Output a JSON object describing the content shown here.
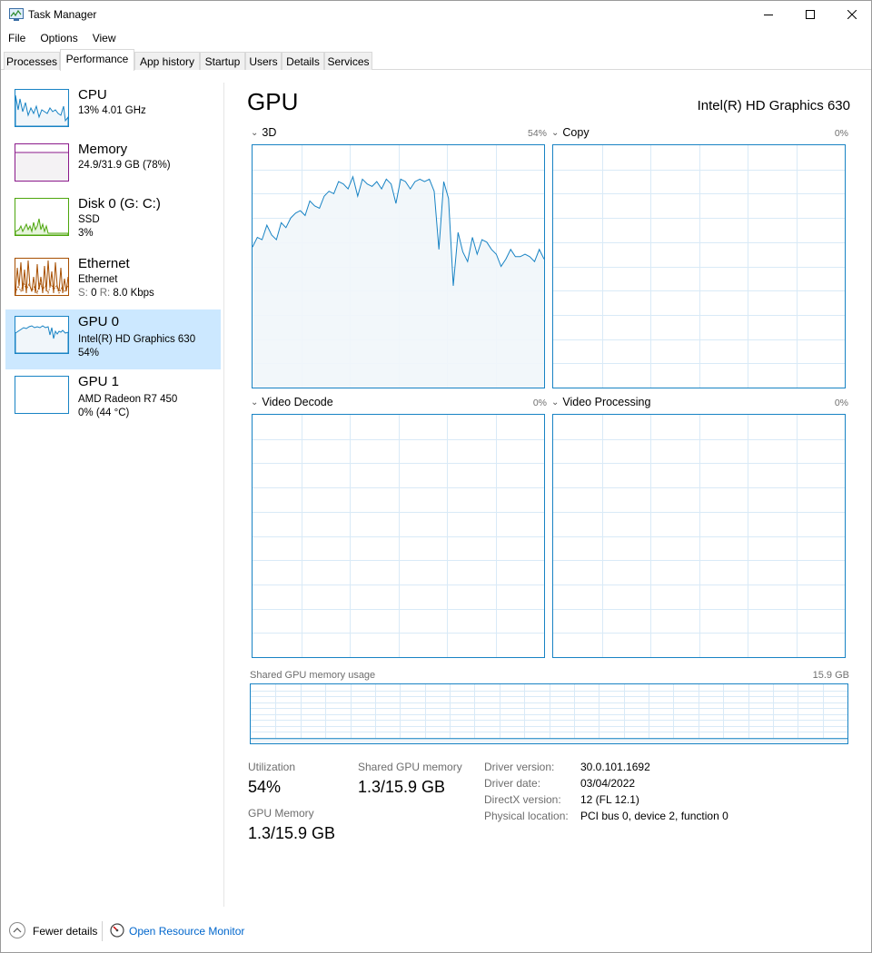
{
  "window": {
    "title": "Task Manager"
  },
  "menu": [
    "File",
    "Options",
    "View"
  ],
  "tabs": [
    "Processes",
    "Performance",
    "App history",
    "Startup",
    "Users",
    "Details",
    "Services"
  ],
  "active_tab": "Performance",
  "sidebar": {
    "items": [
      {
        "title": "CPU",
        "lines": [
          "13%  4.01 GHz"
        ],
        "color": "#1883c4"
      },
      {
        "title": "Memory",
        "lines": [
          "24.9/31.9 GB (78%)"
        ],
        "color": "#8b1a8b"
      },
      {
        "title": "Disk 0 (G: C:)",
        "lines": [
          "SSD",
          "3%"
        ],
        "color": "#4da60c"
      },
      {
        "title": "Ethernet",
        "lines": [
          "Ethernet"
        ],
        "send_label": "S:",
        "send_value": "0",
        "recv_label": "R:",
        "recv_value": "8.0 Kbps",
        "color": "#a74f01"
      },
      {
        "title": "GPU 0",
        "lines": [
          "Intel(R) HD Graphics 630",
          "54%"
        ],
        "color": "#1883c4"
      },
      {
        "title": "GPU 1",
        "lines": [
          "AMD Radeon R7 450",
          "0% (44 °C)"
        ],
        "color": "#1883c4"
      }
    ],
    "selected_index": 4
  },
  "main": {
    "title": "GPU",
    "device_name": "Intel(R) HD Graphics 630",
    "engines": [
      {
        "label": "3D",
        "percent": "54%"
      },
      {
        "label": "Copy",
        "percent": "0%"
      },
      {
        "label": "Video Decode",
        "percent": "0%"
      },
      {
        "label": "Video Processing",
        "percent": "0%"
      }
    ],
    "shared_memory_graph": {
      "label": "Shared GPU memory usage",
      "max": "15.9 GB"
    },
    "stats": {
      "utilization_label": "Utilization",
      "utilization_value": "54%",
      "shared_label": "Shared GPU memory",
      "shared_value": "1.3/15.9 GB",
      "gpu_memory_label": "GPU Memory",
      "gpu_memory_value": "1.3/15.9 GB"
    },
    "info": [
      {
        "label": "Driver version:",
        "value": "30.0.101.1692"
      },
      {
        "label": "Driver date:",
        "value": "03/04/2022"
      },
      {
        "label": "DirectX version:",
        "value": "12 (FL 12.1)"
      },
      {
        "label": "Physical location:",
        "value": "PCI bus 0, device 2, function 0"
      }
    ]
  },
  "footer": {
    "fewer_details": "Fewer details",
    "resource_monitor": "Open Resource Monitor"
  },
  "colors": {
    "accent": "#1883c4",
    "selection": "#cce8ff",
    "link": "#0066cc"
  },
  "graph_3d_samples": [
    58,
    62,
    61,
    67,
    63,
    61,
    68,
    66,
    70,
    72,
    73,
    71,
    77,
    75,
    74,
    79,
    81,
    80,
    85,
    84,
    82,
    87,
    79,
    86,
    84,
    83,
    85,
    82,
    86,
    84,
    76,
    86,
    85,
    82,
    85,
    86,
    85,
    86,
    81,
    57,
    85,
    78,
    42,
    64,
    56,
    52,
    62,
    55,
    61,
    60,
    57,
    55,
    50,
    53,
    57,
    54,
    54,
    55,
    54,
    52,
    57,
    53
  ],
  "graph_shared_memory_samples": [
    8,
    8,
    8,
    8,
    8,
    8,
    8,
    8,
    8,
    8,
    8,
    8,
    8,
    8,
    8,
    8,
    8,
    8,
    8,
    8,
    8,
    8,
    8,
    8,
    8,
    8,
    8,
    8,
    8,
    8,
    8,
    8,
    8,
    8,
    8,
    8,
    8,
    8,
    8,
    8,
    8,
    8,
    8,
    8,
    8,
    8,
    8,
    8,
    8,
    8,
    8,
    8,
    8,
    8,
    8,
    8,
    8,
    8,
    8,
    8,
    8,
    8,
    8,
    8,
    8,
    8,
    8,
    8,
    8,
    8,
    8,
    8,
    8,
    8,
    8,
    8,
    8,
    8,
    8,
    8,
    8,
    8,
    8,
    8,
    8,
    8,
    8,
    8,
    8,
    8,
    8,
    8,
    8,
    8,
    8,
    8,
    8,
    8,
    8,
    8
  ]
}
